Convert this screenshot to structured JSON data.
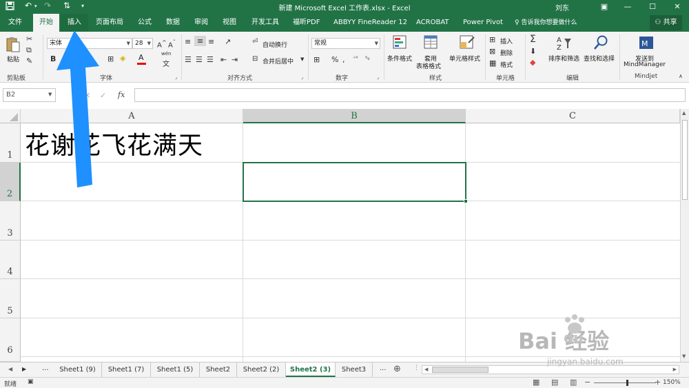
{
  "titlebar": {
    "doc_title": "新建 Microsoft Excel 工作表.xlsx  -  Excel",
    "user_name": "刘东"
  },
  "tabs": [
    "文件",
    "开始",
    "插入",
    "页面布局",
    "公式",
    "数据",
    "审阅",
    "视图",
    "开发工具",
    "福昕PDF",
    "ABBYY FineReader 12",
    "ACROBAT",
    "Power Pivot"
  ],
  "tell_me": "告诉我你想要做什么",
  "share_label": "共享",
  "ribbon": {
    "clipboard": {
      "paste": "粘贴",
      "label": "剪贴板"
    },
    "font": {
      "name": "宋体",
      "size": "28",
      "label": "字体",
      "wen": "wén"
    },
    "alignment": {
      "wrap": "自动换行",
      "merge": "合并后居中",
      "label": "对齐方式"
    },
    "number": {
      "format": "常规",
      "label": "数字"
    },
    "styles": {
      "cond_format": "条件格式",
      "table_format_1": "套用",
      "table_format_2": "表格格式",
      "cell_styles": "单元格样式",
      "label": "样式"
    },
    "cells": {
      "insert": "插入",
      "delete": "删除",
      "format": "格式",
      "label": "单元格"
    },
    "editing": {
      "sort_filter": "排序和筛选",
      "find_select": "查找和选择",
      "label": "编辑"
    },
    "mindjet": {
      "send_1": "发送到",
      "send_2": "MindManager",
      "label": "Mindjet"
    }
  },
  "formula_bar": {
    "name_box": "B2",
    "fx": "fx",
    "content": ""
  },
  "grid": {
    "columns": [
      "A",
      "B",
      "C"
    ],
    "selected_column": "B",
    "rows": [
      "1",
      "2",
      "3",
      "4",
      "5",
      "6"
    ],
    "selected_row": "2",
    "cells": {
      "A1": "花谢花飞花满天"
    }
  },
  "sheet_tabs": [
    "Sheet1 (9)",
    "Sheet1 (7)",
    "Sheet1 (5)",
    "Sheet2",
    "Sheet2 (2)",
    "Sheet2 (3)",
    "Sheet3"
  ],
  "active_sheet": "Sheet2 (3)",
  "sheet_nav": {
    "more": "...",
    "more_right": "..."
  },
  "status": {
    "ready": "就绪",
    "zoom": "150%"
  },
  "watermark": {
    "brand": "Bai 经验",
    "du": "du",
    "url": "jingyan.baidu.com"
  },
  "colors": {
    "excel_green": "#217346",
    "arrow_blue": "#1e90ff"
  }
}
